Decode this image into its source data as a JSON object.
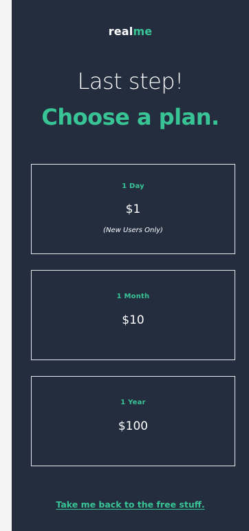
{
  "brand": {
    "logo_part_1": "real",
    "logo_part_2": "me",
    "accent_color": "#39c495",
    "panel_color": "#232d3e"
  },
  "header": {
    "line_1": "Last step!",
    "line_2": "Choose a plan."
  },
  "plans": [
    {
      "name": "1 Day",
      "price": "$1",
      "note": "(New Users Only)"
    },
    {
      "name": "1 Month",
      "price": "$10"
    },
    {
      "name": "1 Year",
      "price": "$100"
    }
  ],
  "footer": {
    "back_link": "Take me back to the free stuff."
  }
}
